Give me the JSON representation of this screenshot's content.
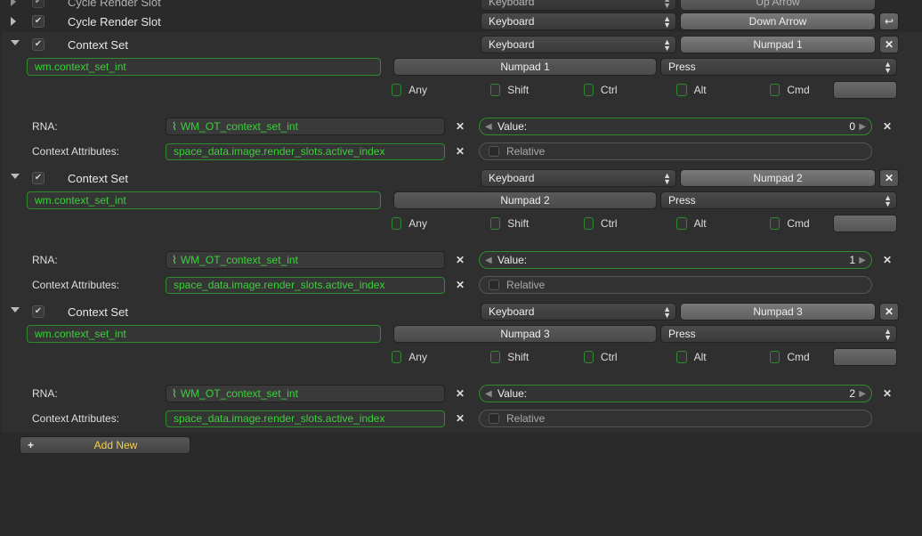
{
  "top": {
    "slot0": {
      "name": "Cycle Render Slot",
      "type": "Keyboard",
      "key": "Up Arrow"
    },
    "slot1": {
      "name": "Cycle Render Slot",
      "type": "Keyboard",
      "key": "Down Arrow"
    }
  },
  "entries": [
    {
      "name": "Context Set",
      "type": "Keyboard",
      "shortcut": "Numpad 1",
      "op": "wm.context_set_int",
      "key": "Numpad 1",
      "event": "Press",
      "mods": {
        "any": "Any",
        "shift": "Shift",
        "ctrl": "Ctrl",
        "alt": "Alt",
        "cmd": "Cmd"
      },
      "rna_label": "RNA:",
      "rna": "WM_OT_context_set_int",
      "ctx_label": "Context Attributes:",
      "ctx": "space_data.image.render_slots.active_index",
      "value_label": "Value:",
      "value": "0",
      "relative": "Relative"
    },
    {
      "name": "Context Set",
      "type": "Keyboard",
      "shortcut": "Numpad 2",
      "op": "wm.context_set_int",
      "key": "Numpad 2",
      "event": "Press",
      "mods": {
        "any": "Any",
        "shift": "Shift",
        "ctrl": "Ctrl",
        "alt": "Alt",
        "cmd": "Cmd"
      },
      "rna_label": "RNA:",
      "rna": "WM_OT_context_set_int",
      "ctx_label": "Context Attributes:",
      "ctx": "space_data.image.render_slots.active_index",
      "value_label": "Value:",
      "value": "1",
      "relative": "Relative"
    },
    {
      "name": "Context Set",
      "type": "Keyboard",
      "shortcut": "Numpad 3",
      "op": "wm.context_set_int",
      "key": "Numpad 3",
      "event": "Press",
      "mods": {
        "any": "Any",
        "shift": "Shift",
        "ctrl": "Ctrl",
        "alt": "Alt",
        "cmd": "Cmd"
      },
      "rna_label": "RNA:",
      "rna": "WM_OT_context_set_int",
      "ctx_label": "Context Attributes:",
      "ctx": "space_data.image.render_slots.active_index",
      "value_label": "Value:",
      "value": "2",
      "relative": "Relative"
    }
  ],
  "add_new": "Add New"
}
